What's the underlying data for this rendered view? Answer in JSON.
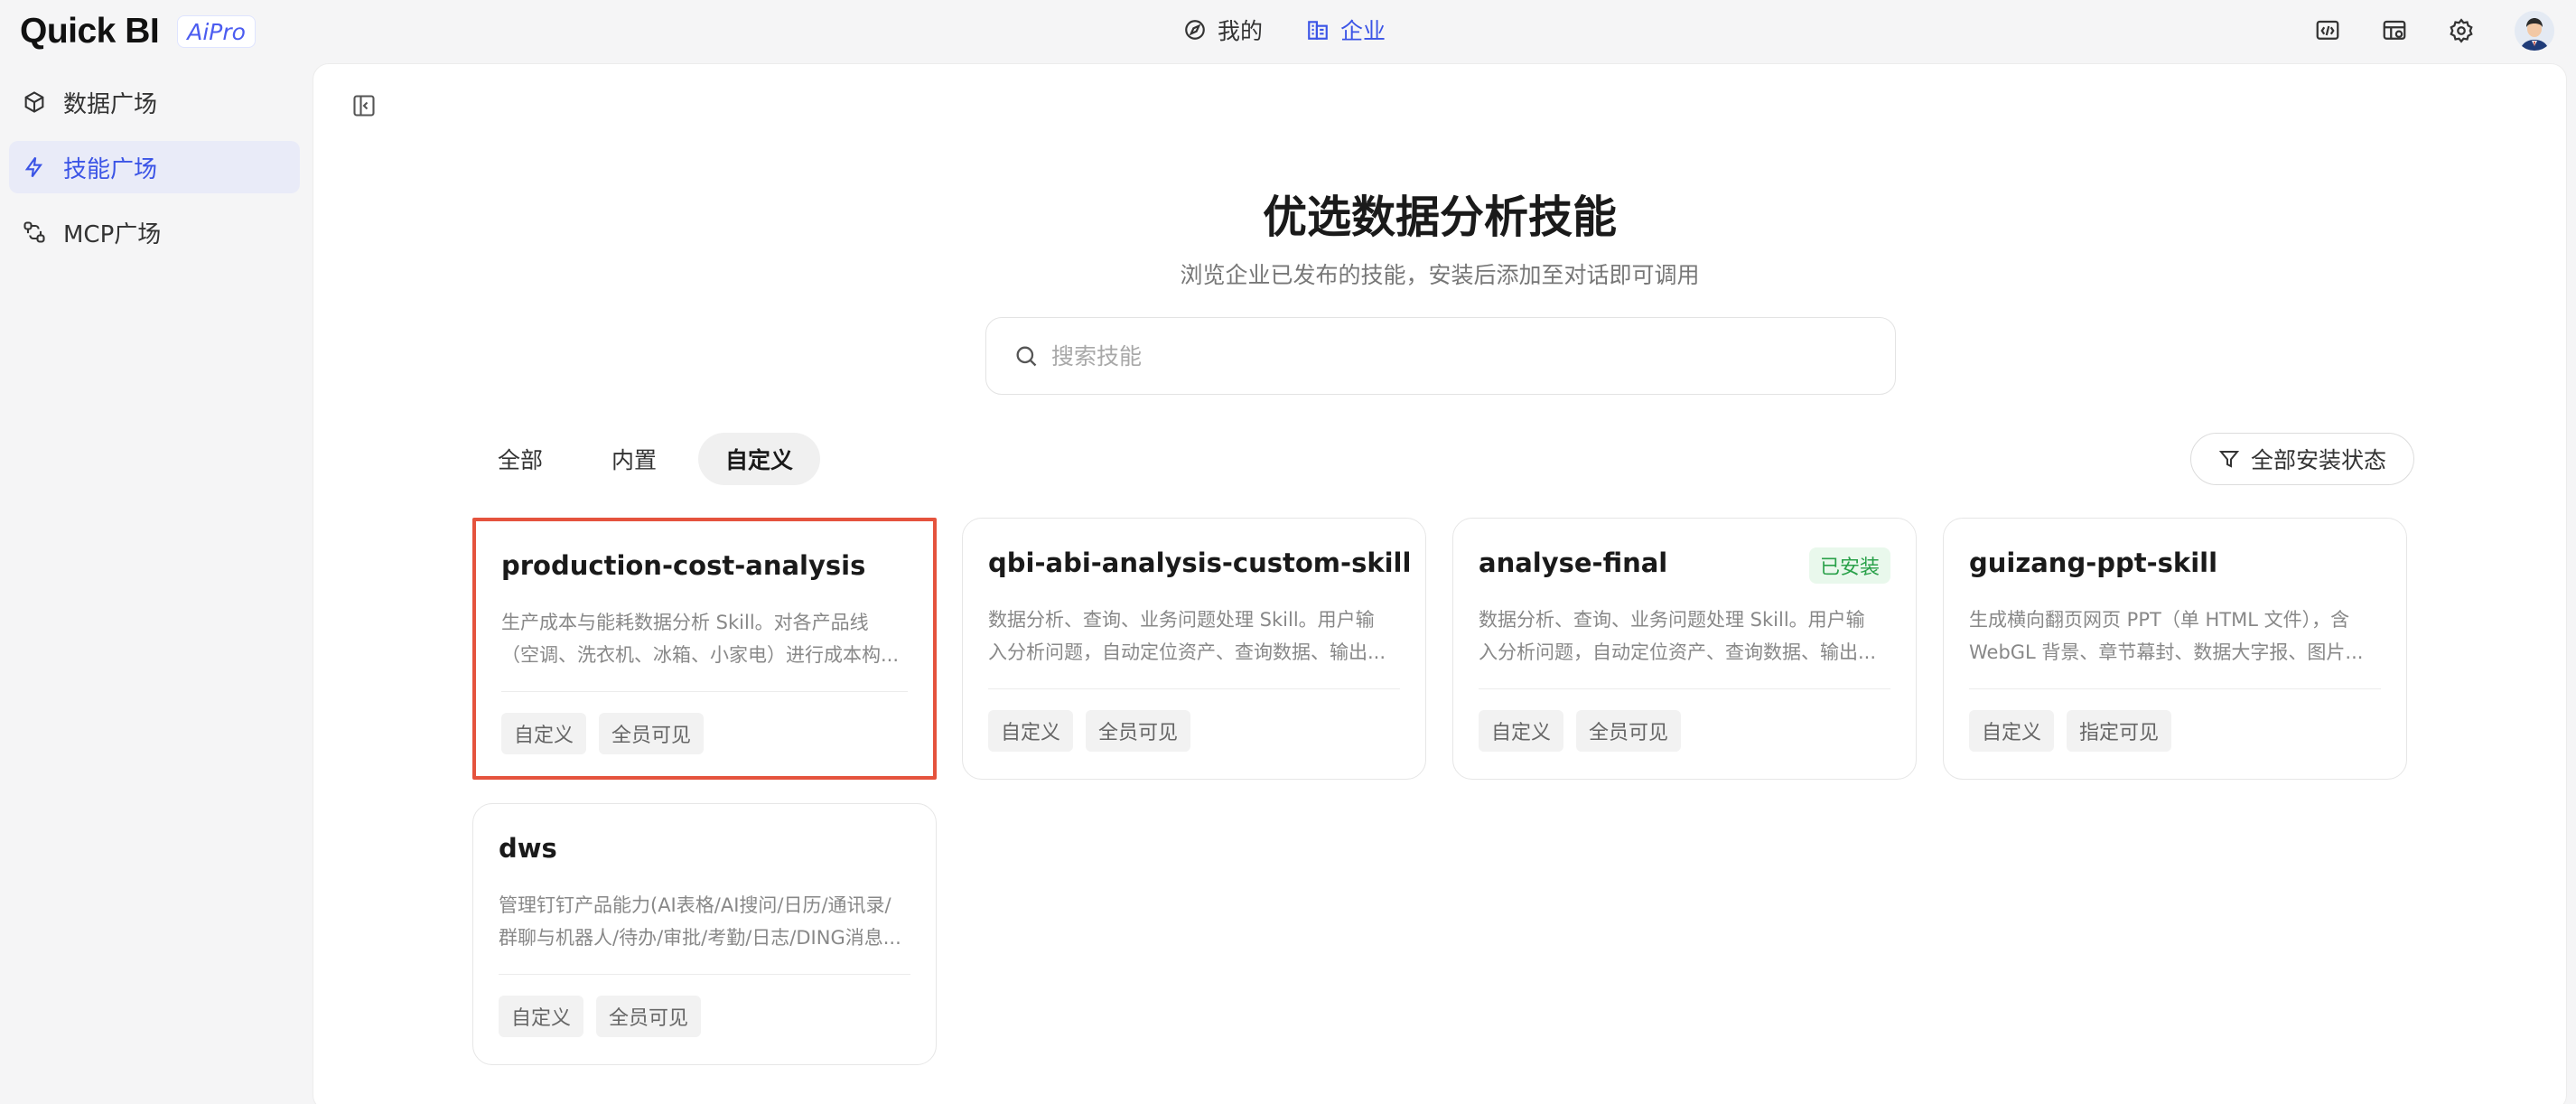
{
  "app": {
    "logo_text": "Quick BI",
    "logo_badge": "AiPro"
  },
  "topnav": {
    "items": [
      {
        "label": "我的",
        "icon": "compass-icon",
        "active": false
      },
      {
        "label": "企业",
        "icon": "building-icon",
        "active": true
      }
    ]
  },
  "top_right_icons": [
    "code-window-icon",
    "dashboard-settings-icon",
    "gear-icon",
    "avatar"
  ],
  "sidebar": {
    "items": [
      {
        "label": "数据广场",
        "icon": "cube-icon",
        "active": false
      },
      {
        "label": "技能广场",
        "icon": "lightning-icon",
        "active": true
      },
      {
        "label": "MCP广场",
        "icon": "link-nodes-icon",
        "active": false
      }
    ]
  },
  "main": {
    "title": "优选数据分析技能",
    "subtitle": "浏览企业已发布的技能，安装后添加至对话即可调用",
    "search": {
      "placeholder": "搜索技能",
      "value": ""
    },
    "tabs": [
      {
        "label": "全部",
        "active": false
      },
      {
        "label": "内置",
        "active": false
      },
      {
        "label": "自定义",
        "active": true
      }
    ],
    "filter_label": "全部安装状态",
    "cards": [
      {
        "title": "production-cost-analysis",
        "badge": "",
        "desc_line1": "生产成本与能耗数据分析 Skill。对各产品线",
        "desc_line2": "（空调、洗衣机、冰箱、小家电）进行成本构...",
        "tags": [
          "自定义",
          "全员可见"
        ],
        "selected": true
      },
      {
        "title": "qbi-abi-analysis-custom-skill",
        "badge": "",
        "desc_line1": "数据分析、查询、业务问题处理 Skill。用户输",
        "desc_line2": "入分析问题，自动定位资产、查询数据、输出...",
        "tags": [
          "自定义",
          "全员可见"
        ],
        "selected": false
      },
      {
        "title": "analyse-final",
        "badge": "已安装",
        "desc_line1": "数据分析、查询、业务问题处理 Skill。用户输",
        "desc_line2": "入分析问题，自动定位资产、查询数据、输出...",
        "tags": [
          "自定义",
          "全员可见"
        ],
        "selected": false
      },
      {
        "title": "guizang-ppt-skill",
        "badge": "",
        "desc_line1": "生成横向翻页网页 PPT（单 HTML 文件），含",
        "desc_line2": "WebGL 背景、章节幕封、数据大字报、图片...",
        "tags": [
          "自定义",
          "指定可见"
        ],
        "selected": false
      },
      {
        "title": "dws",
        "badge": "",
        "desc_line1": "管理钉钉产品能力(AI表格/AI搜问/日历/通讯录/",
        "desc_line2": "群聊与机器人/待办/审批/考勤/日志/DING消息...",
        "tags": [
          "自定义",
          "全员可见"
        ],
        "selected": false
      }
    ]
  },
  "colors": {
    "accent": "#3b54e6",
    "selection_outline": "#e5533d",
    "installed_green": "#2aa14a"
  }
}
